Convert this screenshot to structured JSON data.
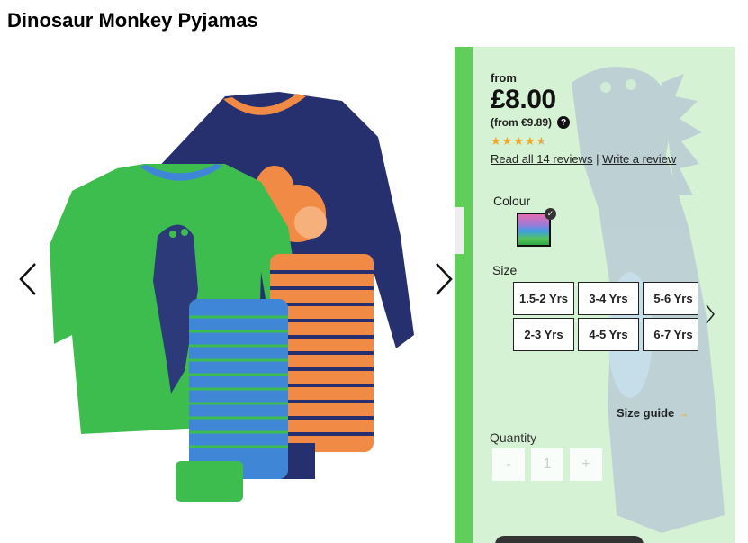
{
  "product": {
    "title": "Dinosaur Monkey Pyjamas"
  },
  "gallery": {
    "prev_icon": "chevron-left-icon",
    "next_icon": "chevron-right-icon"
  },
  "pricing": {
    "from_label": "from",
    "price": "£8.00",
    "alt_price": "(from €9.89)",
    "help_icon": "?"
  },
  "rating": {
    "stars": 4.5,
    "max": 5,
    "read_reviews": "Read all 14 reviews",
    "separator": "|",
    "write_review": "Write a review"
  },
  "colour": {
    "label": "Colour",
    "selected_check": "✓"
  },
  "size": {
    "label": "Size",
    "options": [
      "1.5-2 Yrs",
      "3-4 Yrs",
      "5-6 Yrs",
      "2-3 Yrs",
      "4-5 Yrs",
      "6-7 Yrs"
    ],
    "guide_label": "Size guide",
    "guide_arrow": "→"
  },
  "quantity": {
    "label": "Quantity",
    "minus": "-",
    "value": "1",
    "plus": "+"
  },
  "colors": {
    "panel_bg": "#d6f2d4",
    "panel_stripe": "#5fcf5a",
    "star": "#f5a623"
  }
}
